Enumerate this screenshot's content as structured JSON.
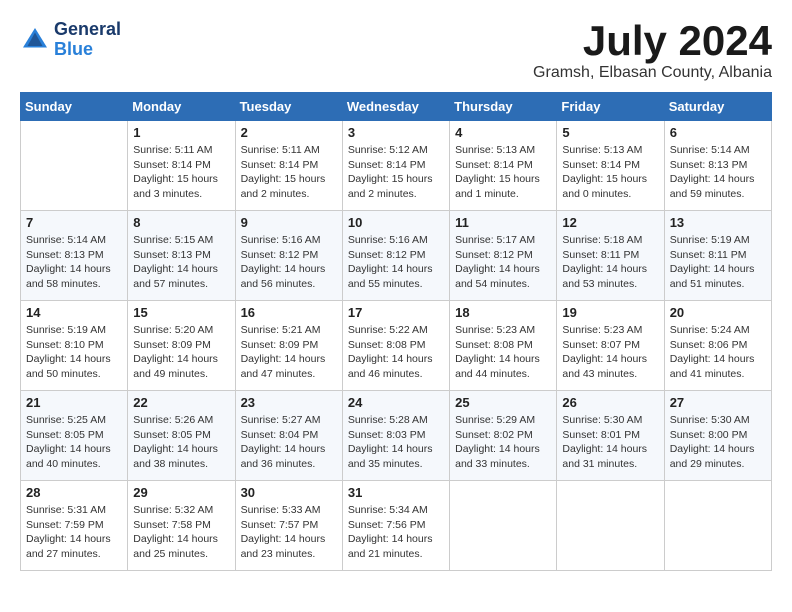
{
  "header": {
    "logo_general": "General",
    "logo_blue": "Blue",
    "month_year": "July 2024",
    "location": "Gramsh, Elbasan County, Albania"
  },
  "weekdays": [
    "Sunday",
    "Monday",
    "Tuesday",
    "Wednesday",
    "Thursday",
    "Friday",
    "Saturday"
  ],
  "weeks": [
    [
      {
        "day": "",
        "sunrise": "",
        "sunset": "",
        "daylight": ""
      },
      {
        "day": "1",
        "sunrise": "Sunrise: 5:11 AM",
        "sunset": "Sunset: 8:14 PM",
        "daylight": "Daylight: 15 hours and 3 minutes."
      },
      {
        "day": "2",
        "sunrise": "Sunrise: 5:11 AM",
        "sunset": "Sunset: 8:14 PM",
        "daylight": "Daylight: 15 hours and 2 minutes."
      },
      {
        "day": "3",
        "sunrise": "Sunrise: 5:12 AM",
        "sunset": "Sunset: 8:14 PM",
        "daylight": "Daylight: 15 hours and 2 minutes."
      },
      {
        "day": "4",
        "sunrise": "Sunrise: 5:13 AM",
        "sunset": "Sunset: 8:14 PM",
        "daylight": "Daylight: 15 hours and 1 minute."
      },
      {
        "day": "5",
        "sunrise": "Sunrise: 5:13 AM",
        "sunset": "Sunset: 8:14 PM",
        "daylight": "Daylight: 15 hours and 0 minutes."
      },
      {
        "day": "6",
        "sunrise": "Sunrise: 5:14 AM",
        "sunset": "Sunset: 8:13 PM",
        "daylight": "Daylight: 14 hours and 59 minutes."
      }
    ],
    [
      {
        "day": "7",
        "sunrise": "Sunrise: 5:14 AM",
        "sunset": "Sunset: 8:13 PM",
        "daylight": "Daylight: 14 hours and 58 minutes."
      },
      {
        "day": "8",
        "sunrise": "Sunrise: 5:15 AM",
        "sunset": "Sunset: 8:13 PM",
        "daylight": "Daylight: 14 hours and 57 minutes."
      },
      {
        "day": "9",
        "sunrise": "Sunrise: 5:16 AM",
        "sunset": "Sunset: 8:12 PM",
        "daylight": "Daylight: 14 hours and 56 minutes."
      },
      {
        "day": "10",
        "sunrise": "Sunrise: 5:16 AM",
        "sunset": "Sunset: 8:12 PM",
        "daylight": "Daylight: 14 hours and 55 minutes."
      },
      {
        "day": "11",
        "sunrise": "Sunrise: 5:17 AM",
        "sunset": "Sunset: 8:12 PM",
        "daylight": "Daylight: 14 hours and 54 minutes."
      },
      {
        "day": "12",
        "sunrise": "Sunrise: 5:18 AM",
        "sunset": "Sunset: 8:11 PM",
        "daylight": "Daylight: 14 hours and 53 minutes."
      },
      {
        "day": "13",
        "sunrise": "Sunrise: 5:19 AM",
        "sunset": "Sunset: 8:11 PM",
        "daylight": "Daylight: 14 hours and 51 minutes."
      }
    ],
    [
      {
        "day": "14",
        "sunrise": "Sunrise: 5:19 AM",
        "sunset": "Sunset: 8:10 PM",
        "daylight": "Daylight: 14 hours and 50 minutes."
      },
      {
        "day": "15",
        "sunrise": "Sunrise: 5:20 AM",
        "sunset": "Sunset: 8:09 PM",
        "daylight": "Daylight: 14 hours and 49 minutes."
      },
      {
        "day": "16",
        "sunrise": "Sunrise: 5:21 AM",
        "sunset": "Sunset: 8:09 PM",
        "daylight": "Daylight: 14 hours and 47 minutes."
      },
      {
        "day": "17",
        "sunrise": "Sunrise: 5:22 AM",
        "sunset": "Sunset: 8:08 PM",
        "daylight": "Daylight: 14 hours and 46 minutes."
      },
      {
        "day": "18",
        "sunrise": "Sunrise: 5:23 AM",
        "sunset": "Sunset: 8:08 PM",
        "daylight": "Daylight: 14 hours and 44 minutes."
      },
      {
        "day": "19",
        "sunrise": "Sunrise: 5:23 AM",
        "sunset": "Sunset: 8:07 PM",
        "daylight": "Daylight: 14 hours and 43 minutes."
      },
      {
        "day": "20",
        "sunrise": "Sunrise: 5:24 AM",
        "sunset": "Sunset: 8:06 PM",
        "daylight": "Daylight: 14 hours and 41 minutes."
      }
    ],
    [
      {
        "day": "21",
        "sunrise": "Sunrise: 5:25 AM",
        "sunset": "Sunset: 8:05 PM",
        "daylight": "Daylight: 14 hours and 40 minutes."
      },
      {
        "day": "22",
        "sunrise": "Sunrise: 5:26 AM",
        "sunset": "Sunset: 8:05 PM",
        "daylight": "Daylight: 14 hours and 38 minutes."
      },
      {
        "day": "23",
        "sunrise": "Sunrise: 5:27 AM",
        "sunset": "Sunset: 8:04 PM",
        "daylight": "Daylight: 14 hours and 36 minutes."
      },
      {
        "day": "24",
        "sunrise": "Sunrise: 5:28 AM",
        "sunset": "Sunset: 8:03 PM",
        "daylight": "Daylight: 14 hours and 35 minutes."
      },
      {
        "day": "25",
        "sunrise": "Sunrise: 5:29 AM",
        "sunset": "Sunset: 8:02 PM",
        "daylight": "Daylight: 14 hours and 33 minutes."
      },
      {
        "day": "26",
        "sunrise": "Sunrise: 5:30 AM",
        "sunset": "Sunset: 8:01 PM",
        "daylight": "Daylight: 14 hours and 31 minutes."
      },
      {
        "day": "27",
        "sunrise": "Sunrise: 5:30 AM",
        "sunset": "Sunset: 8:00 PM",
        "daylight": "Daylight: 14 hours and 29 minutes."
      }
    ],
    [
      {
        "day": "28",
        "sunrise": "Sunrise: 5:31 AM",
        "sunset": "Sunset: 7:59 PM",
        "daylight": "Daylight: 14 hours and 27 minutes."
      },
      {
        "day": "29",
        "sunrise": "Sunrise: 5:32 AM",
        "sunset": "Sunset: 7:58 PM",
        "daylight": "Daylight: 14 hours and 25 minutes."
      },
      {
        "day": "30",
        "sunrise": "Sunrise: 5:33 AM",
        "sunset": "Sunset: 7:57 PM",
        "daylight": "Daylight: 14 hours and 23 minutes."
      },
      {
        "day": "31",
        "sunrise": "Sunrise: 5:34 AM",
        "sunset": "Sunset: 7:56 PM",
        "daylight": "Daylight: 14 hours and 21 minutes."
      },
      {
        "day": "",
        "sunrise": "",
        "sunset": "",
        "daylight": ""
      },
      {
        "day": "",
        "sunrise": "",
        "sunset": "",
        "daylight": ""
      },
      {
        "day": "",
        "sunrise": "",
        "sunset": "",
        "daylight": ""
      }
    ]
  ]
}
